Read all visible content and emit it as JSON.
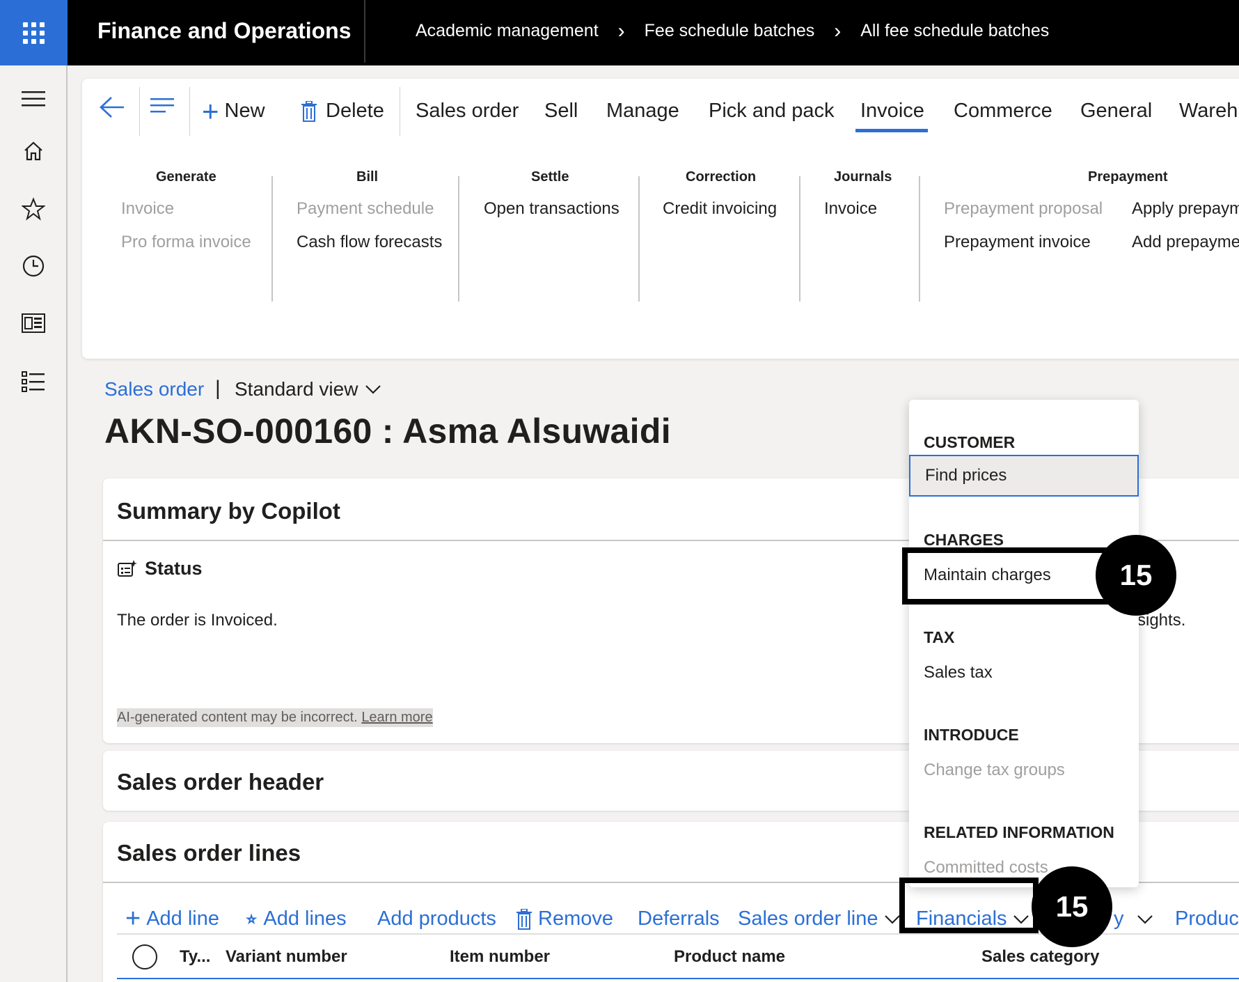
{
  "app": {
    "title": "Finance and Operations",
    "breadcrumb": [
      "Academic management",
      "Fee schedule batches",
      "All fee schedule batches"
    ]
  },
  "actionpane": {
    "new_label": "New",
    "delete_label": "Delete",
    "tabs": [
      "Sales order",
      "Sell",
      "Manage",
      "Pick and pack",
      "Invoice",
      "Commerce",
      "General",
      "Wareh"
    ],
    "active_tab": "Invoice",
    "groups": {
      "generate": {
        "title": "Generate",
        "items": [
          "Invoice",
          "Pro forma invoice"
        ]
      },
      "bill": {
        "title": "Bill",
        "items": [
          "Payment schedule",
          "Cash flow forecasts"
        ]
      },
      "settle": {
        "title": "Settle",
        "items": [
          "Open transactions"
        ]
      },
      "correction": {
        "title": "Correction",
        "items": [
          "Credit invoicing"
        ]
      },
      "journals": {
        "title": "Journals",
        "items": [
          "Invoice"
        ]
      },
      "prepayment": {
        "title": "Prepayment",
        "items": [
          "Prepayment proposal",
          "Prepayment invoice",
          "Apply prepaym",
          "Add prepayme"
        ]
      }
    }
  },
  "page": {
    "form_name": "Sales order",
    "pipe": "|",
    "view": "Standard view",
    "record_title": "AKN-SO-000160 : Asma Alsuwaidi"
  },
  "copilot": {
    "title": "Summary by Copilot",
    "status_label": "Status",
    "status_text": "The order is Invoiced.",
    "insights_tail": "sights.",
    "disclaimer": "AI-generated content may be incorrect.",
    "learn_more": "Learn more"
  },
  "header_card": {
    "title": "Sales order header"
  },
  "lines_card": {
    "title": "Sales order lines",
    "toolbar": {
      "add_line": "Add line",
      "add_lines": "Add lines",
      "add_products": "Add products",
      "remove": "Remove",
      "deferrals": "Deferrals",
      "sales_order_line": "Sales order line",
      "financials": "Financials",
      "hidden_tail": "y",
      "product": "Product"
    },
    "columns": [
      "Ty...",
      "Variant number",
      "Item number",
      "Product name",
      "Sales category"
    ]
  },
  "menu": {
    "sections": {
      "customer": {
        "title": "CUSTOMER",
        "items": [
          "Find prices"
        ]
      },
      "charges": {
        "title": "CHARGES",
        "items": [
          "Maintain charges"
        ]
      },
      "tax": {
        "title": "TAX",
        "items": [
          "Sales tax"
        ]
      },
      "introduce": {
        "title": "INTRODUCE",
        "items": [
          "Change tax groups"
        ]
      },
      "related": {
        "title": "RELATED INFORMATION",
        "items": [
          "Committed costs"
        ]
      }
    }
  },
  "annotations": {
    "badge_1": "15",
    "badge_2": "15"
  },
  "colors": {
    "accent": "#2b6fd6",
    "waffle_bg": "#2b6fd6",
    "topbar": "#000000",
    "callout": "#000000"
  }
}
